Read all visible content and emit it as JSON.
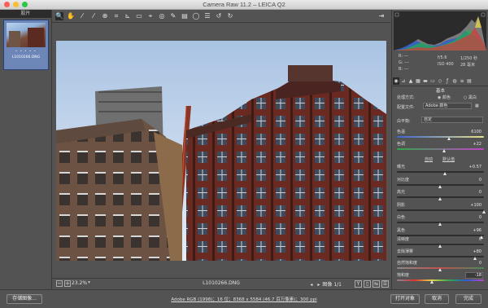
{
  "window": {
    "title": "Camera Raw 11.2  –  LEICA Q2"
  },
  "filmstrip": {
    "header": "胶片",
    "thumbnail": {
      "stars": "• • • • •",
      "filename": "L1010266.DNG"
    }
  },
  "toolbar": {
    "tools": [
      {
        "icon": "zoom-icon",
        "glyph": "🔍"
      },
      {
        "icon": "hand-icon",
        "glyph": "✋"
      },
      {
        "icon": "white-balance-icon",
        "glyph": "⁄"
      },
      {
        "icon": "color-sampler-icon",
        "glyph": "⁄"
      },
      {
        "icon": "target-adjust-icon",
        "glyph": "⊕"
      },
      {
        "icon": "crop-icon",
        "glyph": "⌗"
      },
      {
        "icon": "straighten-icon",
        "glyph": "⊾"
      },
      {
        "icon": "transform-icon",
        "glyph": "▭"
      },
      {
        "icon": "spot-removal-icon",
        "glyph": "⌖"
      },
      {
        "icon": "red-eye-icon",
        "glyph": "◎"
      },
      {
        "icon": "brush-icon",
        "glyph": "✎"
      },
      {
        "icon": "graduated-filter-icon",
        "glyph": "▤"
      },
      {
        "icon": "radial-filter-icon",
        "glyph": "◯"
      },
      {
        "icon": "preferences-icon",
        "glyph": "☰"
      },
      {
        "icon": "rotate-left-icon",
        "glyph": "↺"
      },
      {
        "icon": "rotate-right-icon",
        "glyph": "↻"
      }
    ],
    "toggle_glyph": "⇥"
  },
  "preview": {
    "zoom_minus": "−",
    "zoom_plus": "+",
    "zoom_value": "23.2%",
    "zoom_caret": "▾",
    "filename": "L1010266.DNG",
    "nav_prev": "◂",
    "nav_next": "▸",
    "nav_label": "图像 1/1",
    "view_buttons": [
      "Y",
      "▯",
      "⇆",
      "☰"
    ]
  },
  "histogram": {
    "readout": {
      "r_label": "R:",
      "r_value": "---",
      "g_label": "G:",
      "g_value": "---",
      "b_label": "B:",
      "b_value": "---",
      "aperture": "f/5.6",
      "shutter": "1/250 秒",
      "iso": "ISO 400",
      "focal": "28 毫米"
    }
  },
  "panel": {
    "section_title": "基本",
    "treatment_label": "处理方式:",
    "treatment_color": "颜色",
    "treatment_bw": "黑白",
    "profile_label": "配置文件:",
    "profile_value": "Adobe 颜色",
    "wb_label": "白平衡:",
    "wb_value": "自定",
    "temp_label": "色温",
    "temp_value": "6100",
    "tint_label": "色调",
    "tint_value": "+22",
    "auto_label": "自动",
    "default_label": "默认值",
    "sliders": [
      {
        "label": "曝光",
        "value": "+0.57",
        "pos": 0.56
      },
      {
        "label": "对比度",
        "value": "0",
        "pos": 0.5
      },
      {
        "label": "高光",
        "value": "0",
        "pos": 0.5
      },
      {
        "label": "阴影",
        "value": "+100",
        "pos": 1.0
      },
      {
        "label": "白色",
        "value": "0",
        "pos": 0.5
      },
      {
        "label": "黑色",
        "value": "+96",
        "pos": 0.98
      }
    ],
    "presence": [
      {
        "label": "清晰度",
        "value": "0",
        "pos": 0.5
      },
      {
        "label": "去除薄雾",
        "value": "+80",
        "pos": 0.9
      },
      {
        "label": "自然饱和度",
        "value": "0",
        "pos": 0.5
      },
      {
        "label": "饱和度",
        "value": "-18",
        "pos": 0.41
      }
    ]
  },
  "bottom": {
    "save_label": "存储图像...",
    "workflow_label": "Adobe RGB (1998)；16 位；8368 x 5584 (46.7 百万像素)；300 ppi",
    "open_label": "打开对象",
    "cancel_label": "取消",
    "done_label": "完成"
  },
  "colors": {
    "accent": "#6d86b8",
    "panel": "#535353",
    "dark": "#2b2b2b"
  }
}
